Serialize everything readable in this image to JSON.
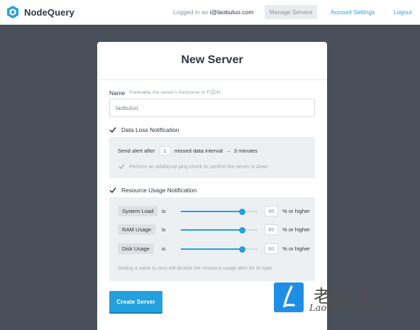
{
  "brand": {
    "name": "NodeQuery",
    "accent": "#24a0dc",
    "icon": "nodequery-hexagon-logo-icon"
  },
  "nav": {
    "logged_in_prefix": "Logged in as",
    "user_email": "i@laobuluo.com",
    "manage_servers": "Manage Servers",
    "account_settings": "Account Settings",
    "logout": "Logout"
  },
  "form": {
    "title": "New Server",
    "name_label": "Name",
    "name_hint": "Preferably the server's hostname or FQDN",
    "name_value": "laobuluo",
    "data_loss": {
      "label": "Data Loss Notification",
      "checked": true,
      "send_alert_prefix": "Send alert after",
      "missed_value": "1",
      "missed_suffix": "missed data interval",
      "arrow": "→",
      "result": "3 minutes",
      "ping_check_label": "Perform an additional ping check to confirm the server is down",
      "ping_checked": true
    },
    "resource_usage": {
      "label": "Resource Usage Notification",
      "checked": true,
      "is_word": "is",
      "suffix": "% or higher",
      "items": [
        {
          "label": "System Load",
          "value": "80",
          "level": 0.8
        },
        {
          "label": "RAM Usage",
          "value": "80",
          "level": 0.8
        },
        {
          "label": "Disk Usage",
          "value": "80",
          "level": 0.8
        }
      ],
      "note": "Setting a value to zero will disable the resource usage alert for its type"
    },
    "submit": "Create Server"
  },
  "watermark": {
    "chinese": "老部落",
    "latin": "LaoBuLuo.com",
    "badge_letter": "L",
    "badge_color": "#1f8fe6"
  }
}
